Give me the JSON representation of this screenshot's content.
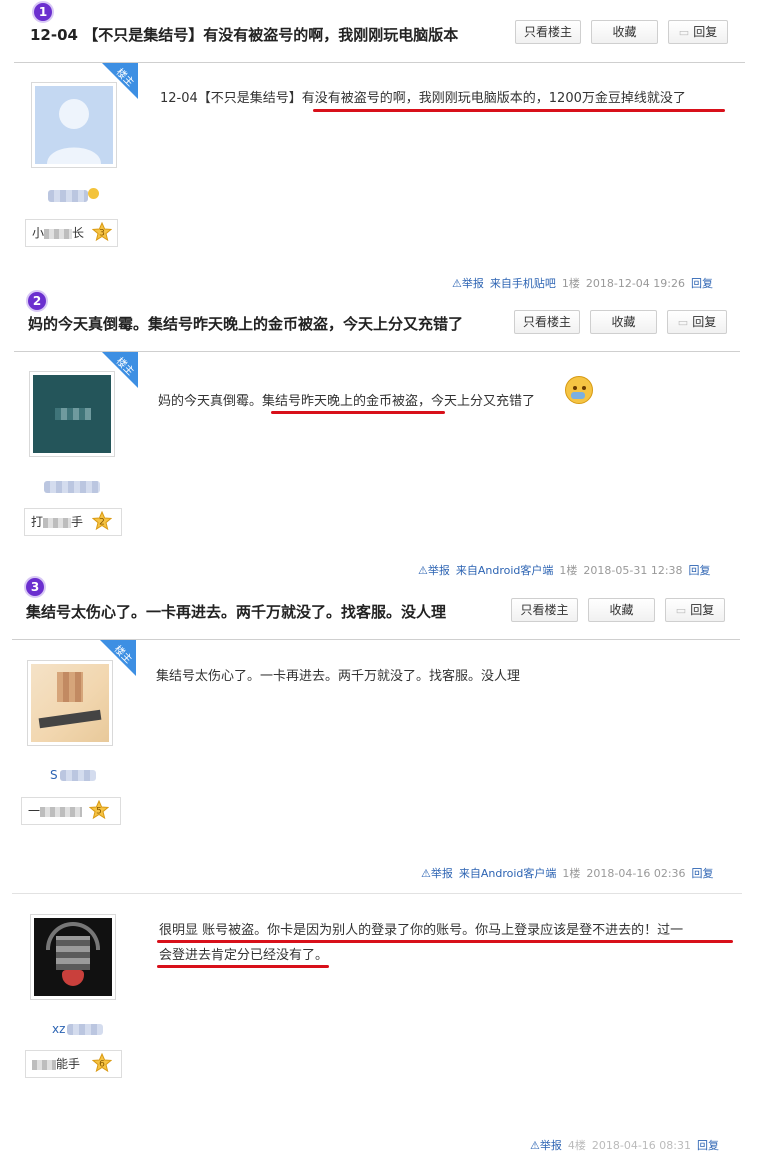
{
  "threads": [
    {
      "badge": "1",
      "title": "12-04 【不只是集结号】有没有被盗号的啊，我刚刚玩电脑版本",
      "buttons": {
        "only_op": "只看楼主",
        "fav": "收藏",
        "reply": "回复"
      },
      "op_ribbon": "楼主",
      "username_level": "小",
      "username_level_tail": "长",
      "level": "3",
      "post_body": "12-04【不只是集结号】有没有被盗号的啊，我刚刚玩电脑版本的，1200万金豆掉线就没了",
      "meta": {
        "report": "⚠举报",
        "source": "来自手机贴吧",
        "floor": "1楼",
        "time": "2018-12-04 19:26",
        "reply": "回复"
      }
    },
    {
      "badge": "2",
      "title": "妈的今天真倒霉。集结号昨天晚上的金币被盗，今天上分又充错了",
      "buttons": {
        "only_op": "只看楼主",
        "fav": "收藏",
        "reply": "回复"
      },
      "op_ribbon": "楼主",
      "username_level": "打",
      "username_level_tail": "手",
      "level": "2",
      "post_body": "妈的今天真倒霉。集结号昨天晚上的金币被盗，今天上分又充错了",
      "meta": {
        "report": "⚠举报",
        "source": "来自Android客户端",
        "floor": "1楼",
        "time": "2018-05-31 12:38",
        "reply": "回复"
      }
    },
    {
      "badge": "3",
      "title": "集结号太伤心了。一卡再进去。两千万就没了。找客服。没人理",
      "buttons": {
        "only_op": "只看楼主",
        "fav": "收藏",
        "reply": "回复"
      },
      "op_ribbon": "楼主",
      "username": "S",
      "username_level": "一",
      "username_level_tail": "",
      "level": "5",
      "post_body": "集结号太伤心了。一卡再进去。两千万就没了。找客服。没人理",
      "meta": {
        "report": "⚠举报",
        "source": "来自Android客户端",
        "floor": "1楼",
        "time": "2018-04-16 02:36",
        "reply": "回复"
      }
    }
  ],
  "reply_post": {
    "username": "xz",
    "username_level_tail": "能手",
    "level": "6",
    "post_body_line1": "很明显 账号被盗。你卡是因为别人的登录了你的账号。你马上登录应该是登不进去的！过一",
    "post_body_line2": "会登进去肯定分已经没有了。",
    "meta": {
      "report": "⚠举报",
      "floor": "4楼",
      "time": "2018-04-16 08:31",
      "reply": "回复"
    }
  },
  "colors": {
    "accent": "#2d64b3",
    "underline": "#d8101a",
    "ribbon": "#3d8fe3",
    "badge": "#6b2fcf"
  }
}
